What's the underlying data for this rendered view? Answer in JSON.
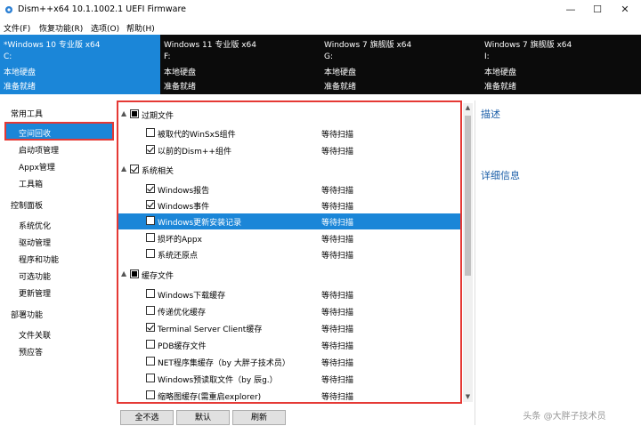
{
  "window": {
    "title": "Dism++x64 10.1.1002.1 UEFI Firmware",
    "controls": {
      "minimize": "—",
      "maximize": "☐",
      "close": "✕"
    }
  },
  "menu": [
    "文件(F)",
    "恢复功能(R)",
    "选项(O)",
    "帮助(H)"
  ],
  "systems": [
    {
      "name": "*Windows 10 专业版 x64",
      "drive": "C:",
      "disk": "本地硬盘",
      "status": "准备就绪"
    },
    {
      "name": "Windows 11 专业版 x64",
      "drive": "F:",
      "disk": "本地硬盘",
      "status": "准备就绪"
    },
    {
      "name": "Windows 7 旗舰版 x64",
      "drive": "G:",
      "disk": "本地硬盘",
      "status": "准备就绪"
    },
    {
      "name": "Windows 7 旗舰版 x64",
      "drive": "I:",
      "disk": "本地硬盘",
      "status": "准备就绪"
    }
  ],
  "sidebar": {
    "cat1": "常用工具",
    "items1": [
      "空间回收",
      "启动项管理",
      "Appx管理",
      "工具箱"
    ],
    "cat2": "控制面板",
    "items2": [
      "系统优化",
      "驱动管理",
      "程序和功能",
      "可选功能",
      "更新管理"
    ],
    "cat3": "部署功能",
    "items3": [
      "文件关联",
      "预应答"
    ]
  },
  "list": {
    "cat1": "过期文件",
    "cat1_items": [
      {
        "label": "被取代的WinSxS组件",
        "status": "等待扫描"
      },
      {
        "label": "以前的Dism++组件",
        "status": "等待扫描"
      }
    ],
    "cat2": "系统相关",
    "cat2_items": [
      {
        "label": "Windows报告",
        "status": "等待扫描"
      },
      {
        "label": "Windows事件",
        "status": "等待扫描"
      },
      {
        "label": "Windows更新安装记录",
        "status": "等待扫描"
      },
      {
        "label": "损坏的Appx",
        "status": "等待扫描"
      },
      {
        "label": "系统还原点",
        "status": "等待扫描"
      }
    ],
    "cat3": "缓存文件",
    "cat3_items": [
      {
        "label": "Windows下载缓存",
        "status": "等待扫描"
      },
      {
        "label": "传递优化缓存",
        "status": "等待扫描"
      },
      {
        "label": "Terminal Server Client缓存",
        "status": "等待扫描"
      },
      {
        "label": "PDB缓存文件",
        "status": "等待扫描"
      },
      {
        "label": "NET程序集缓存（by 大胖子技术员）",
        "status": "等待扫描"
      },
      {
        "label": "Windows预读取文件（by 辰g.）",
        "status": "等待扫描"
      },
      {
        "label": "缩略图缓存(需重启explorer)",
        "status": "等待扫描"
      }
    ]
  },
  "right": {
    "desc_title": "描述",
    "detail_title": "详细信息"
  },
  "buttons": {
    "deselect_all": "全不选",
    "default": "默认",
    "refresh": "刷新"
  },
  "watermark": "头条 @大胖子技术员"
}
